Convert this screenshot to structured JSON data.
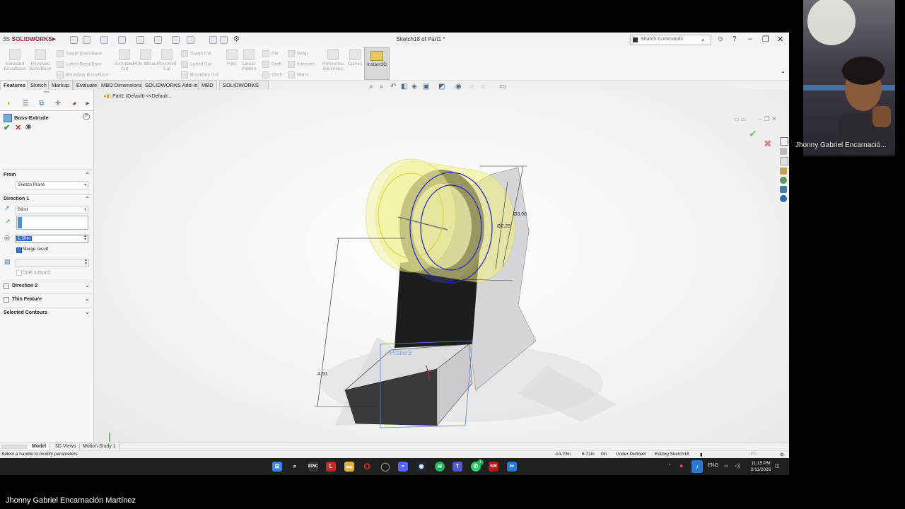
{
  "app": {
    "logo_brand": "3S",
    "logo_name": "SOLIDWORKS",
    "document_title": "Sketch18 of Part1 *",
    "search_placeholder": "Search Commands"
  },
  "command_manager": {
    "buttons": [
      {
        "label": "Extruded Boss/Base"
      },
      {
        "label": "Revolved Boss/Base"
      },
      {
        "label": "Extruded Cut"
      },
      {
        "label": "Hole Wizard"
      },
      {
        "label": "Revolved Cut"
      },
      {
        "label": "Fillet"
      },
      {
        "label": "Linear Pattern"
      },
      {
        "label": "Reference Geometry"
      },
      {
        "label": "Curves"
      },
      {
        "label": "Instant3D"
      }
    ],
    "small_items": [
      "Swept Boss/Base",
      "Lofted Boss/Base",
      "Boundary Boss/Base",
      "Swept Cut",
      "Lofted Cut",
      "Boundary Cut",
      "Rib",
      "Wrap",
      "Draft",
      "Intersect",
      "Shell",
      "Mirror"
    ]
  },
  "tabs": [
    "Features",
    "Sketch",
    "Markup",
    "Evaluate",
    "MBD Dimensions",
    "SOLIDWORKS Add-Ins",
    "MBD",
    "SOLIDWORKS CAM"
  ],
  "tree": {
    "breadcrumb": "Part1 (Default) <<Default..."
  },
  "property_manager": {
    "title": "Boss-Extrude",
    "from_label": "From",
    "from_value": "Sketch Plane",
    "direction1_label": "Direction 1",
    "direction1_type": "Blind",
    "distance_value": "1.50in",
    "merge_result_label": "Merge result",
    "merge_result_checked": true,
    "draft_outward_label": "Draft outward",
    "direction2_label": "Direction 2",
    "thin_feature_label": "Thin Feature",
    "selected_contours_label": "Selected Contours"
  },
  "viewport": {
    "dim_diameter_outer": "Ø3.00",
    "dim_diameter_inner": "Ø2.25",
    "dim_height": "4.50",
    "plane_label": "Plane3",
    "accent_color": "#f0f07a",
    "sketch_color": "#2222cc"
  },
  "bottom_tabs": [
    "Model",
    "3D Views",
    "Motion Study 1"
  ],
  "status": {
    "message": "Select a handle to modify parameters",
    "x": "-14.23in",
    "y": "6.71in",
    "z": "0in",
    "define_state": "Under Defined",
    "editing": "Editing Sketch18",
    "units": "IPS"
  },
  "taskbar": {
    "language": "ENG",
    "time": "11:15 PM",
    "date": "2/11/2026",
    "notification_count": "1"
  },
  "webcam": {
    "participant_name": "Jhonny Gabriel Encarnació..."
  },
  "caption": "Jhonny Gabriel Encarnación Martínez"
}
